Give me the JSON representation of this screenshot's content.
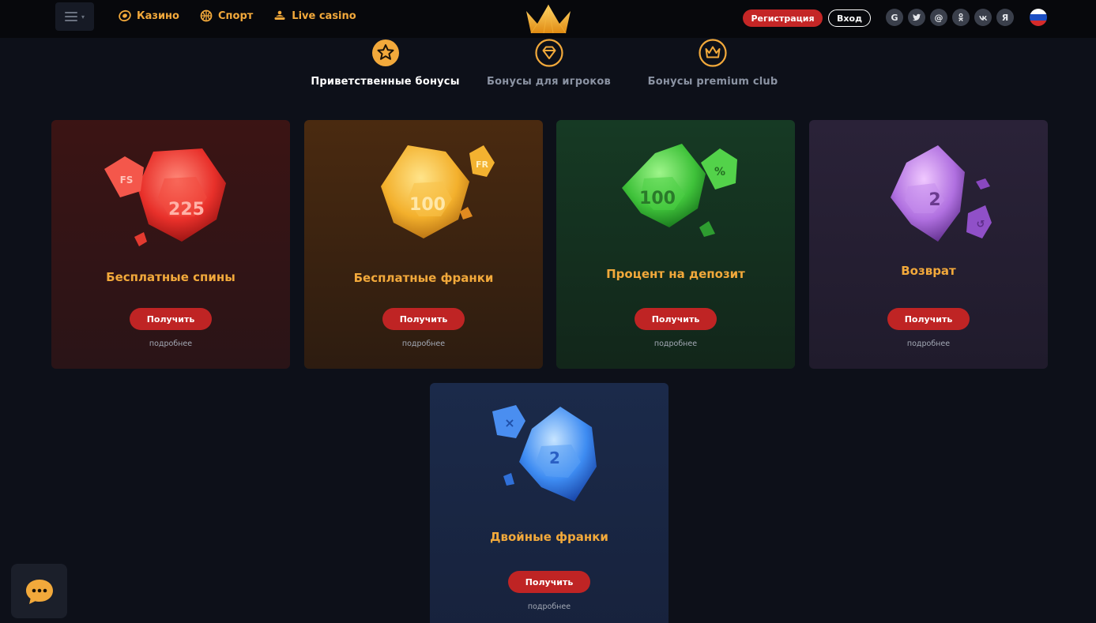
{
  "nav": {
    "items": [
      {
        "label": "Казино",
        "icon": "casino-chip-icon"
      },
      {
        "label": "Спорт",
        "icon": "ball-icon"
      },
      {
        "label": "Live casino",
        "icon": "dealer-icon"
      }
    ]
  },
  "auth": {
    "register_label": "Регистрация",
    "login_label": "Вход"
  },
  "socials": [
    "G",
    "t",
    "@",
    "ok",
    "vk",
    "Я"
  ],
  "colors": {
    "accent": "#f2a93b",
    "button_red": "#bf2424",
    "background": "#0d1019",
    "topbar": "#07080c"
  },
  "tabs": [
    {
      "label": "Приветственные бонусы",
      "icon": "star-icon",
      "active": true
    },
    {
      "label": "Бонусы для игроков",
      "icon": "diamond-icon",
      "active": false
    },
    {
      "label": "Бонусы premium club",
      "icon": "crown-icon",
      "active": false
    }
  ],
  "cards": [
    {
      "title": "Бесплатные спины",
      "gem_main": "225",
      "gem_side": "FS",
      "button": "Получить",
      "more": "подробнее",
      "theme": "red"
    },
    {
      "title": "Бесплатные франки",
      "gem_main": "100",
      "gem_side": "FR",
      "button": "Получить",
      "more": "подробнее",
      "theme": "gold"
    },
    {
      "title": "Процент на депозит",
      "gem_main": "100",
      "gem_side": "%",
      "button": "Получить",
      "more": "подробнее",
      "theme": "green"
    },
    {
      "title": "Возврат",
      "gem_main": "2",
      "gem_side": "↺",
      "button": "Получить",
      "more": "подробнее",
      "theme": "purple"
    },
    {
      "title": "Двойные франки",
      "gem_main": "2",
      "gem_side": "×",
      "button": "Получить",
      "more": "подробнее",
      "theme": "blue"
    }
  ]
}
